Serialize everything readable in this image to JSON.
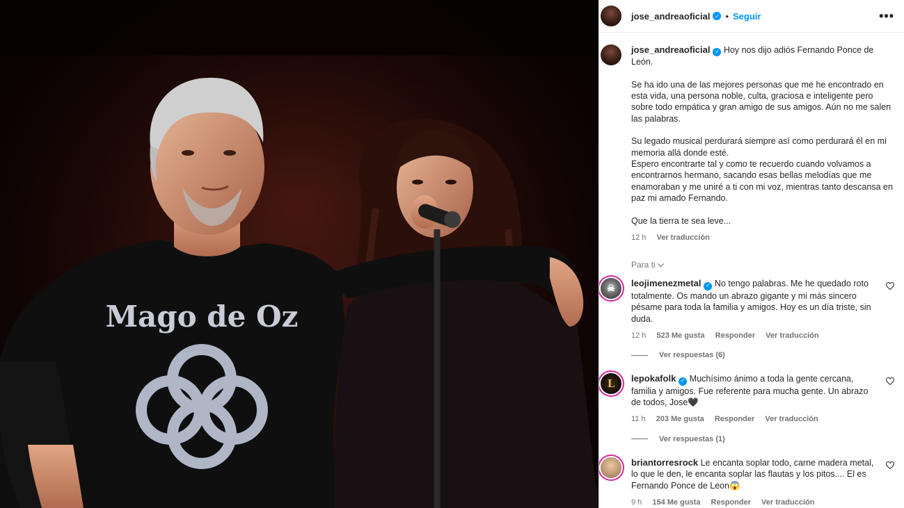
{
  "post": {
    "author": "jose_andreaoficial",
    "follow_label": "Seguir",
    "more_label": "•••",
    "separator": "•",
    "shirt_text": "Mago de Oz"
  },
  "caption": {
    "username": "jose_andreaoficial",
    "lead": "Hoy nos dijo adiós Fernando Ponce de León.",
    "p1": "Se ha ido una de las mejores personas que me he encontrado en esta vida, una persona noble, culta, graciosa e inteligente pero sobre todo empática y gran amigo de sus amigos. Aún no me salen las palabras.",
    "p2a": "Su legado musical perdurará siempre así como perdurará él en mi memoria allá donde esté.",
    "p2b": "Espero encontrarte tal y como te recuerdo cuando volvamos a encontrarnos hermano, sacando esas bellas melodías que me enamoraban y me uniré a ti con mi voz, mientras tanto descansa en paz mi amado Fernando.",
    "p3": "Que la tierra te sea leve...",
    "time": "12 h",
    "translate": "Ver traducción"
  },
  "filter": {
    "label": "Para ti"
  },
  "comments": [
    {
      "username": "leojimenezmetal",
      "verified": true,
      "text": "No tengo palabras. Me he quedado roto totalmente. Os mando un abrazo gigante y mi más sincero pésame para toda la familia y amigos. Hoy es un día triste, sin duda.",
      "time": "12 h",
      "likes": "523 Me gusta",
      "reply": "Responder",
      "translate": "Ver traducción",
      "replies": "Ver respuestas (6)"
    },
    {
      "username": "lepokafolk",
      "verified": true,
      "text": "Muchísimo ánimo a toda la gente cercana, familia y amigos. Fue referente para mucha gente. Un abrazo de todos, Jose🖤",
      "time": "11 h",
      "likes": "203 Me gusta",
      "reply": "Responder",
      "translate": "Ver traducción",
      "replies": "Ver respuestas (1)"
    },
    {
      "username": "briantorresrock",
      "verified": false,
      "text": "Le encanta soplar todo, carne madera metal, lo que le den, le encanta soplar las flautas y los pitos.... El es Fernando Ponce de Leon😱",
      "time": "9 h",
      "likes": "154 Me gusta",
      "reply": "Responder",
      "translate": "Ver traducción"
    }
  ],
  "colors": {
    "accent": "#0095f6",
    "story_ring": "#d6249f",
    "muted": "#737373"
  }
}
